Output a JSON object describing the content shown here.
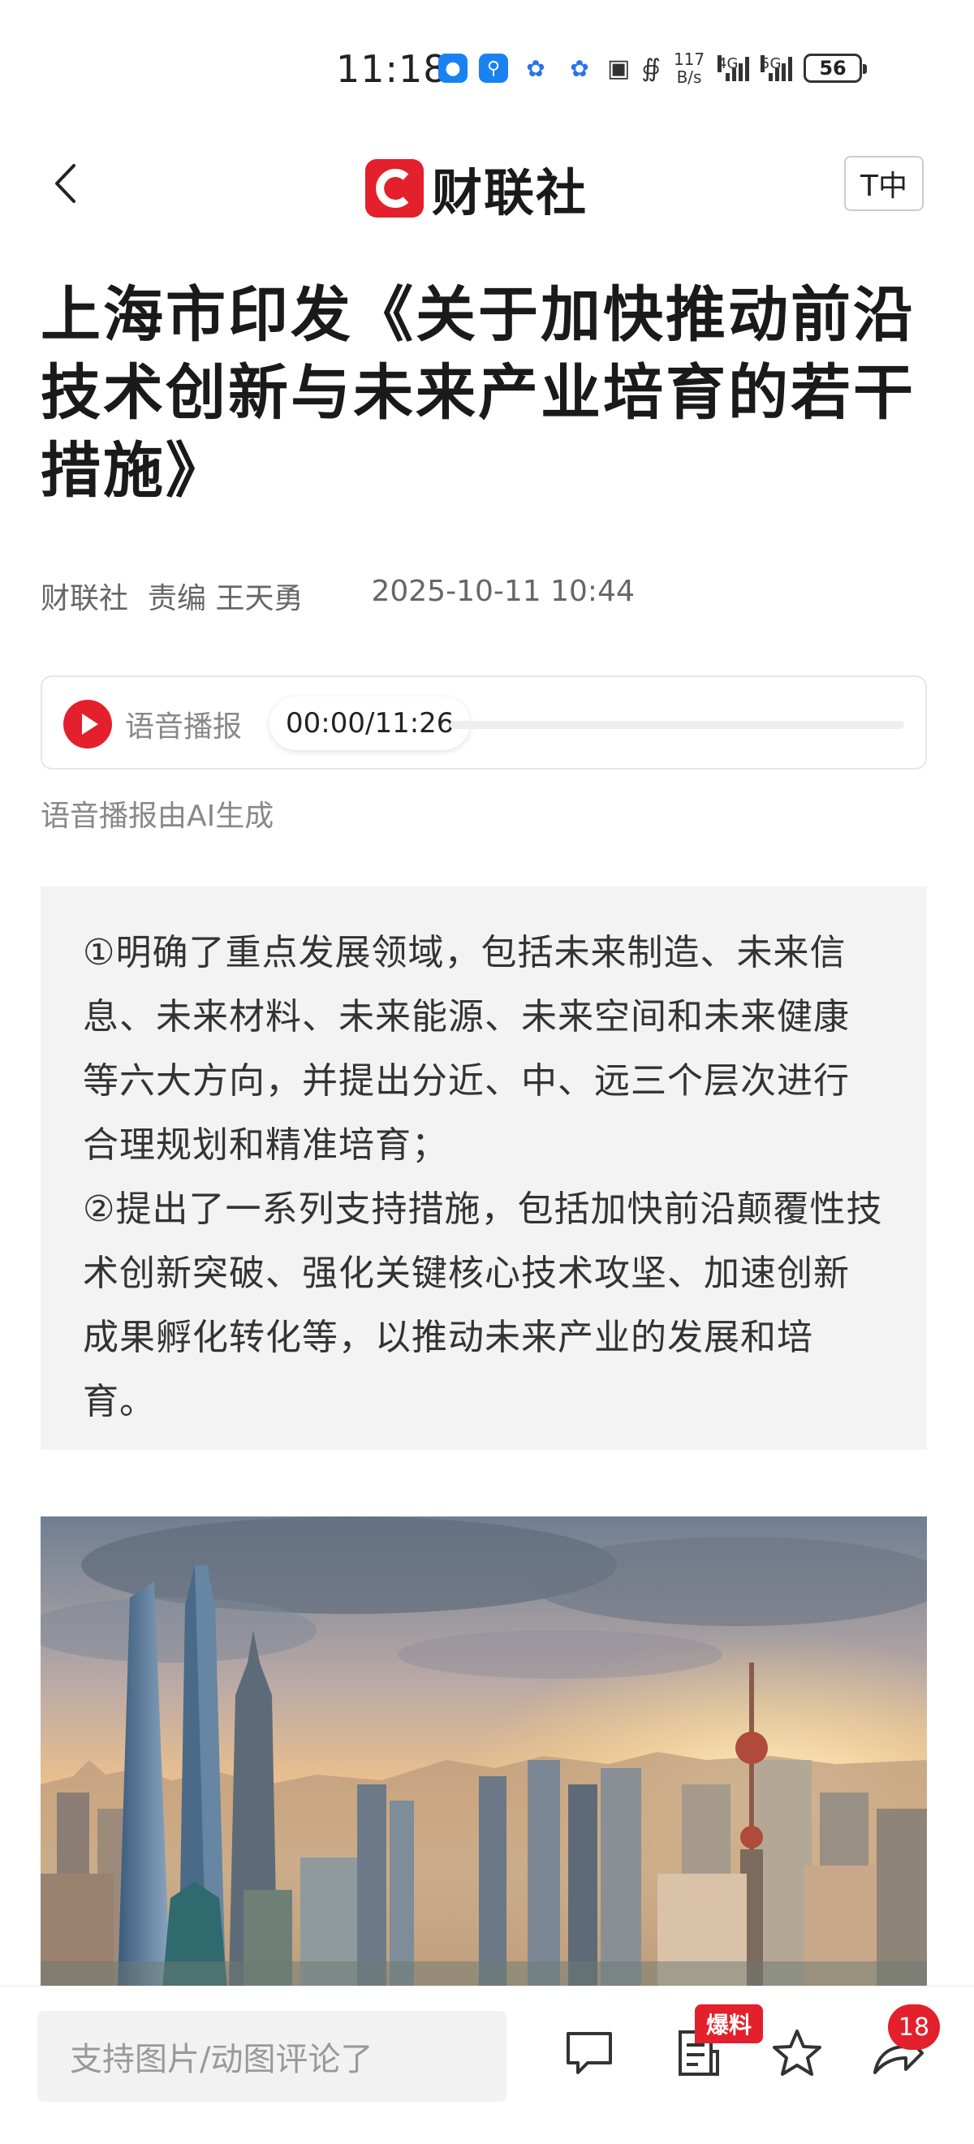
{
  "status_bar": {
    "time": "11:18",
    "net_speed_value": "117",
    "net_speed_unit": "B/s",
    "signal1_label": "4G",
    "signal2_label": "5G",
    "battery": "56",
    "icons": [
      "bulb-app-icon",
      "search-app-icon",
      "paw-app-icon",
      "paw-app-icon",
      "nfc-icon",
      "bluetooth-icon",
      "signal-4g-icon",
      "signal-5g-icon",
      "battery-icon"
    ]
  },
  "header": {
    "logo_text": "财联社",
    "font_size_button": "T中",
    "brand_color": "#e3202b"
  },
  "article": {
    "title": "上海市印发《关于加快推动前沿技术创新与未来产业培育的若干措施》",
    "source": "财联社",
    "editor": "责编 王天勇",
    "datetime": "2025-10-11 10:44"
  },
  "audio": {
    "label": "语音播报",
    "time": "00:00/11:26",
    "progress": 0,
    "note": "语音播报由AI生成"
  },
  "summary": {
    "point1": "①明确了重点发展领域，包括未来制造、未来信息、未来材料、未来能源、未来空间和未来健康等六大方向，并提出分近、中、远三个层次进行合理规划和精准培育；",
    "point2": "②提出了一系列支持措施，包括加快前沿颠覆性技术创新突破、强化关键核心技术攻坚、加速创新成果孵化转化等，以推动未来产业的发展和培育。"
  },
  "bottom_bar": {
    "comment_placeholder": "支持图片/动图评论了",
    "tag_label": "爆料",
    "share_count": "18"
  }
}
